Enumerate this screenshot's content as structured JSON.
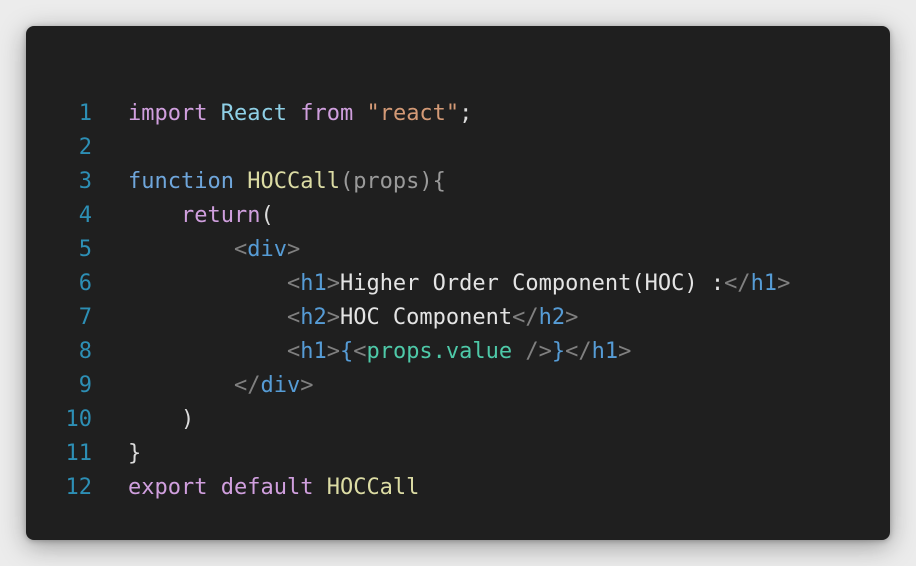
{
  "editor": {
    "lines": [
      {
        "num": "1",
        "tokens": [
          {
            "t": "import",
            "k": "keyword"
          },
          {
            "t": " ",
            "k": "plain"
          },
          {
            "t": "React",
            "k": "class"
          },
          {
            "t": " ",
            "k": "plain"
          },
          {
            "t": "from",
            "k": "keyword"
          },
          {
            "t": " ",
            "k": "plain"
          },
          {
            "t": "\"react\"",
            "k": "string"
          },
          {
            "t": ";",
            "k": "plain"
          }
        ]
      },
      {
        "num": "2",
        "tokens": []
      },
      {
        "num": "3",
        "tokens": [
          {
            "t": "function",
            "k": "decl"
          },
          {
            "t": " ",
            "k": "plain"
          },
          {
            "t": "HOCCall",
            "k": "func"
          },
          {
            "t": "(",
            "k": "param"
          },
          {
            "t": "props",
            "k": "param"
          },
          {
            "t": "){",
            "k": "param"
          }
        ]
      },
      {
        "num": "4",
        "tokens": [
          {
            "t": "    ",
            "k": "plain"
          },
          {
            "t": "return",
            "k": "keyword"
          },
          {
            "t": "(",
            "k": "plain"
          }
        ]
      },
      {
        "num": "5",
        "tokens": [
          {
            "t": "        ",
            "k": "plain"
          },
          {
            "t": "<",
            "k": "tagbr"
          },
          {
            "t": "div",
            "k": "tag"
          },
          {
            "t": ">",
            "k": "tagbr"
          }
        ]
      },
      {
        "num": "6",
        "tokens": [
          {
            "t": "            ",
            "k": "plain"
          },
          {
            "t": "<",
            "k": "tagbr"
          },
          {
            "t": "h1",
            "k": "tag"
          },
          {
            "t": ">",
            "k": "tagbr"
          },
          {
            "t": "Higher Order Component(HOC) :",
            "k": "text"
          },
          {
            "t": "</",
            "k": "tagbr"
          },
          {
            "t": "h1",
            "k": "tag"
          },
          {
            "t": ">",
            "k": "tagbr"
          }
        ]
      },
      {
        "num": "7",
        "tokens": [
          {
            "t": "            ",
            "k": "plain"
          },
          {
            "t": "<",
            "k": "tagbr"
          },
          {
            "t": "h2",
            "k": "tag"
          },
          {
            "t": ">",
            "k": "tagbr"
          },
          {
            "t": "HOC Component",
            "k": "text"
          },
          {
            "t": "</",
            "k": "tagbr"
          },
          {
            "t": "h2",
            "k": "tag"
          },
          {
            "t": ">",
            "k": "tagbr"
          }
        ]
      },
      {
        "num": "8",
        "tokens": [
          {
            "t": "            ",
            "k": "plain"
          },
          {
            "t": "<",
            "k": "tagbr"
          },
          {
            "t": "h1",
            "k": "tag"
          },
          {
            "t": ">",
            "k": "tagbr"
          },
          {
            "t": "{",
            "k": "brace"
          },
          {
            "t": "<",
            "k": "tagbr"
          },
          {
            "t": "props.value",
            "k": "jsx"
          },
          {
            "t": " />",
            "k": "tagbr"
          },
          {
            "t": "}",
            "k": "brace"
          },
          {
            "t": "</",
            "k": "tagbr"
          },
          {
            "t": "h1",
            "k": "tag"
          },
          {
            "t": ">",
            "k": "tagbr"
          }
        ]
      },
      {
        "num": "9",
        "tokens": [
          {
            "t": "        ",
            "k": "plain"
          },
          {
            "t": "</",
            "k": "tagbr"
          },
          {
            "t": "div",
            "k": "tag"
          },
          {
            "t": ">",
            "k": "tagbr"
          }
        ]
      },
      {
        "num": "10",
        "tokens": [
          {
            "t": "    ",
            "k": "plain"
          },
          {
            "t": ")",
            "k": "plain"
          }
        ]
      },
      {
        "num": "11",
        "tokens": [
          {
            "t": "}",
            "k": "plain"
          }
        ]
      },
      {
        "num": "12",
        "tokens": [
          {
            "t": "export",
            "k": "keyword"
          },
          {
            "t": " ",
            "k": "plain"
          },
          {
            "t": "default",
            "k": "keyword"
          },
          {
            "t": " ",
            "k": "plain"
          },
          {
            "t": "HOCCall",
            "k": "func"
          }
        ]
      }
    ]
  }
}
